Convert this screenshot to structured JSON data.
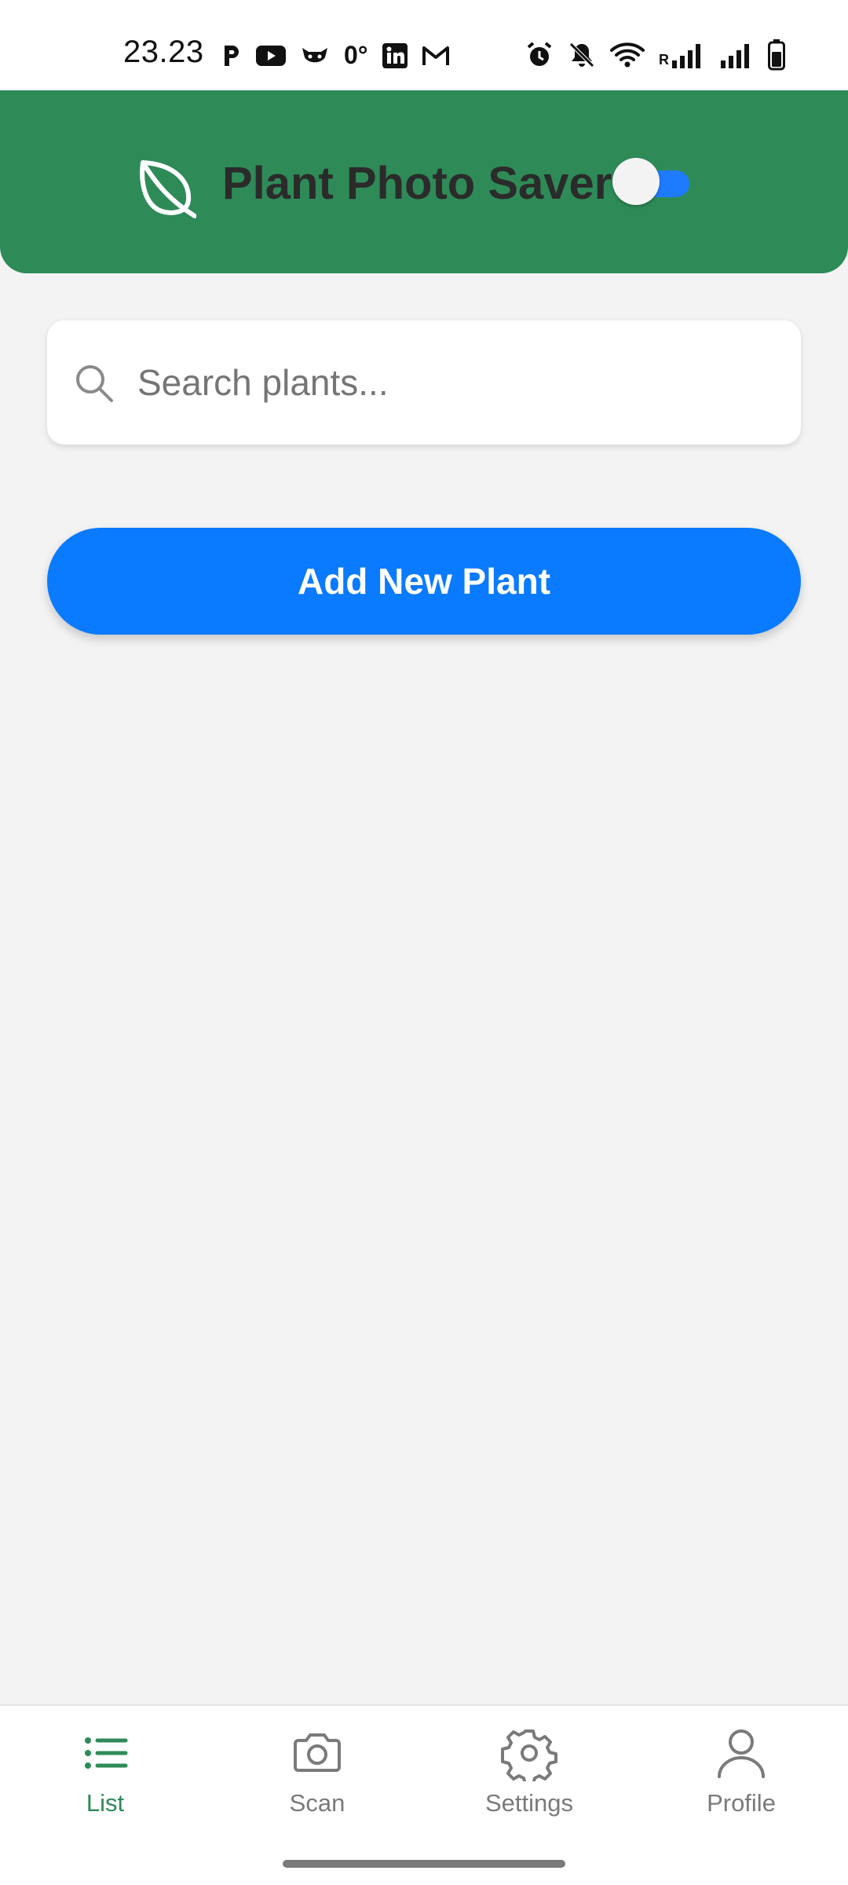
{
  "status_bar": {
    "time": "23.23",
    "left_icons": [
      "p-icon",
      "youtube-icon",
      "cat-icon",
      "zero-degree-icon",
      "linkedin-icon",
      "gmail-icon"
    ],
    "zero_label": "0°",
    "right_icons": [
      "alarm-icon",
      "bell-off-icon",
      "wifi-icon",
      "signal-icon",
      "signal-icon",
      "battery-icon"
    ],
    "signal_roaming_label": "R"
  },
  "header": {
    "title": "Plant Photo Saver",
    "toggle_on": true,
    "colors": {
      "background": "#2e8b57",
      "toggle_track": "#1e7bff"
    }
  },
  "search": {
    "placeholder": "Search plants...",
    "value": ""
  },
  "actions": {
    "add_label": "Add New Plant",
    "color": "#0a7aff"
  },
  "nav": {
    "items": [
      {
        "label": "List",
        "icon": "list-icon",
        "active": true
      },
      {
        "label": "Scan",
        "icon": "camera-icon",
        "active": false
      },
      {
        "label": "Settings",
        "icon": "gear-icon",
        "active": false
      },
      {
        "label": "Profile",
        "icon": "person-icon",
        "active": false
      }
    ],
    "active_color": "#2e8b57",
    "inactive_color": "#7a7a7a"
  }
}
